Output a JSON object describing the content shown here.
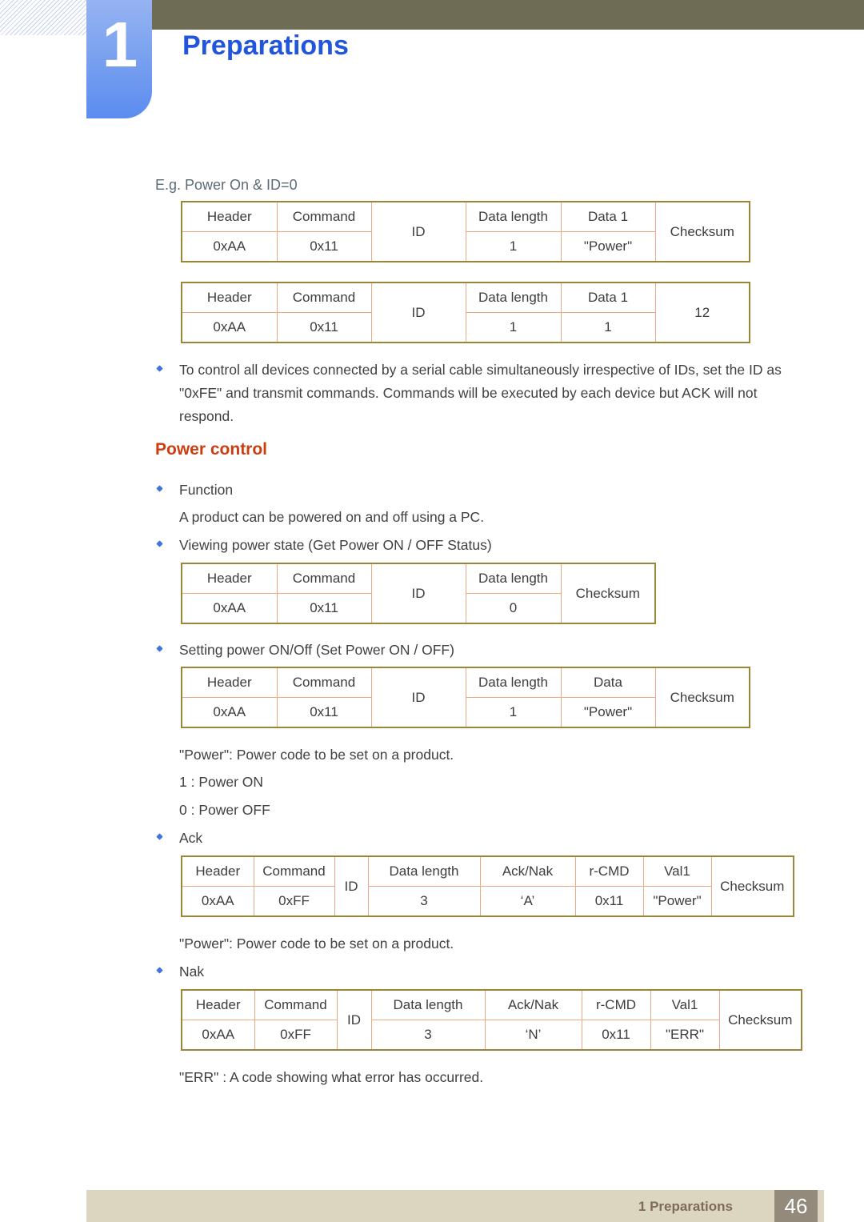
{
  "header": {
    "chapter_number": "1",
    "chapter_title": "Preparations",
    "badge_color": "#6f8ceb",
    "title_color": "#2255dd",
    "band_color": "#6f6c55"
  },
  "footer": {
    "label": "1 Preparations",
    "page_number": "46",
    "bar_color": "#dcd6c1",
    "page_box_color": "#948a7c"
  },
  "content": {
    "eg_label": "E.g. Power On & ID=0",
    "bullet_serial_note": "To control all devices connected by a serial cable simultaneously irrespective of IDs, set the ID as \"0xFE\" and transmit commands. Commands will be executed by each device but ACK will not respond.",
    "section_heading": "Power control",
    "section_heading_color": "#cc3d10",
    "bullet_function": "Function",
    "text_function_desc": "A product can be powered on and off using a PC.",
    "bullet_viewing": "Viewing power state (Get Power ON / OFF Status)",
    "bullet_setting": "Setting power ON/Off (Set Power ON / OFF)",
    "text_power_code_1": "\"Power\": Power code to be set on a product.",
    "text_power_on": "1 : Power ON",
    "text_power_off": "0 : Power OFF",
    "bullet_ack": "Ack",
    "text_power_code_2": "\"Power\": Power code to be set on a product.",
    "bullet_nak": "Nak",
    "text_err": "\"ERR\" : A code showing what error has occurred."
  },
  "tables": {
    "example_request": {
      "headers": [
        "Header",
        "Command",
        "ID",
        "Data length",
        "Data 1",
        "Checksum"
      ],
      "values": [
        "0xAA",
        "0x11",
        "",
        "1",
        "\"Power\"",
        ""
      ],
      "merged": [
        "ID",
        "Checksum"
      ]
    },
    "example_response": {
      "headers": [
        "Header",
        "Command",
        "ID",
        "Data length",
        "Data 1",
        "12"
      ],
      "values": [
        "0xAA",
        "0x11",
        "",
        "1",
        "1",
        ""
      ],
      "merged": [
        "ID",
        "12"
      ]
    },
    "get_power_status": {
      "headers": [
        "Header",
        "Command",
        "ID",
        "Data length",
        "Checksum"
      ],
      "values": [
        "0xAA",
        "0x11",
        "",
        "0",
        ""
      ],
      "merged": [
        "ID",
        "Checksum"
      ]
    },
    "set_power": {
      "headers": [
        "Header",
        "Command",
        "ID",
        "Data length",
        "Data",
        "Checksum"
      ],
      "values": [
        "0xAA",
        "0x11",
        "",
        "1",
        "\"Power\"",
        ""
      ],
      "merged": [
        "ID",
        "Checksum"
      ]
    },
    "ack": {
      "headers": [
        "Header",
        "Command",
        "ID",
        "Data length",
        "Ack/Nak",
        "r-CMD",
        "Val1",
        "Checksum"
      ],
      "values": [
        "0xAA",
        "0xFF",
        "",
        "3",
        "‘A’",
        "0x11",
        "\"Power\"",
        ""
      ],
      "merged": [
        "ID",
        "Checksum"
      ]
    },
    "nak": {
      "headers": [
        "Header",
        "Command",
        "ID",
        "Data length",
        "Ack/Nak",
        "r-CMD",
        "Val1",
        "Checksum"
      ],
      "values": [
        "0xAA",
        "0xFF",
        "",
        "3",
        "‘N’",
        "0x11",
        "\"ERR\"",
        ""
      ],
      "merged": [
        "ID",
        "Checksum"
      ]
    }
  }
}
